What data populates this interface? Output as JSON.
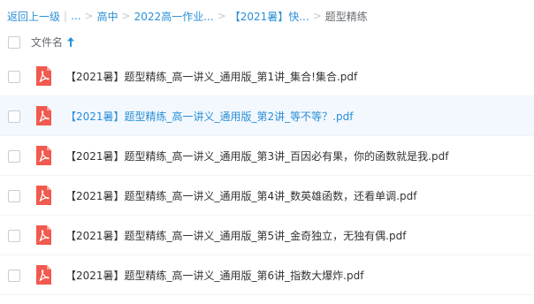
{
  "breadcrumb": {
    "back_label": "返回上一级",
    "ellipsis_label": "...",
    "crumbs": [
      "高中",
      "2022高一作业...",
      "【2021暑】快..."
    ],
    "current": "题型精练"
  },
  "list_header": {
    "name_column_label": "文件名",
    "sort_direction": "ascending"
  },
  "files": [
    {
      "name": "【2021暑】题型精练_高一讲义_通用版_第1讲_集合!集合.pdf",
      "icon": "pdf-icon",
      "selected": false
    },
    {
      "name": "【2021暑】题型精练_高一讲义_通用版_第2讲_等不等？.pdf",
      "icon": "pdf-icon",
      "selected": true
    },
    {
      "name": "【2021暑】题型精练_高一讲义_通用版_第3讲_百因必有果，你的函数就是我.pdf",
      "icon": "pdf-icon",
      "selected": false
    },
    {
      "name": "【2021暑】题型精练_高一讲义_通用版_第4讲_数英雄函数，还看单调.pdf",
      "icon": "pdf-icon",
      "selected": false
    },
    {
      "name": "【2021暑】题型精练_高一讲义_通用版_第5讲_金奇独立，无独有偶.pdf",
      "icon": "pdf-icon",
      "selected": false
    },
    {
      "name": "【2021暑】题型精练_高一讲义_通用版_第6讲_指数大爆炸.pdf",
      "icon": "pdf-icon",
      "selected": false
    }
  ],
  "colors": {
    "link": "#2b8fd6",
    "pdf_icon": "#f15a4f",
    "selected_row_bg": "#f3f8fe"
  }
}
